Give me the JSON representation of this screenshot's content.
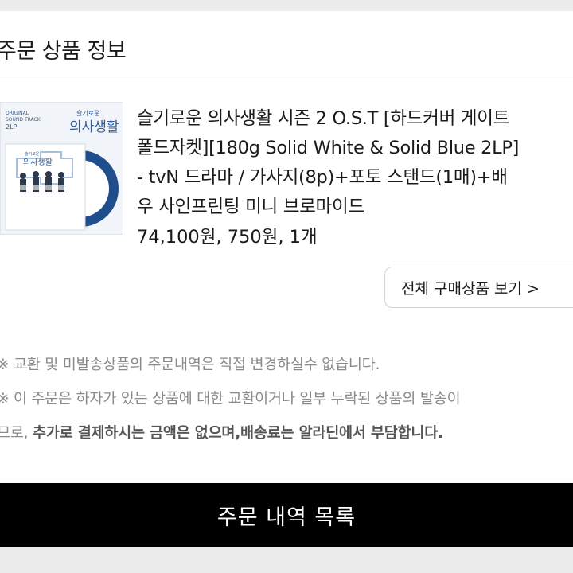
{
  "section": {
    "title": "주문 상품 정보"
  },
  "product": {
    "name_lines": [
      "슬기로운 의사생활 시즌 2 O.S.T [하드커버 게이트",
      "폴드자켓][180g Solid White & Solid Blue 2LP]",
      "- tvN 드라마 / 가사지(8p)+포토 스탠드(1매)+배",
      "우 사인프린팅 미니 브로마이드"
    ],
    "price_line": "74,100원, 750원, 1개",
    "thumbnail": {
      "title_small": "슬기로운",
      "title_large": "의사생활",
      "label_lines": [
        "ORIGINAL",
        "SOUND TRACK",
        "2LP"
      ]
    }
  },
  "view_all_button": {
    "label": "전체 구매상품 보기 >"
  },
  "notices": {
    "line1": "※ 교환 및 미발송상품의 주문내역은 직접 변경하실수 없습니다.",
    "line2": "※ 이 주문은 하자가 있는 상품에 대한 교환이거나 일부 누락된 상품의 발송이",
    "line3_prefix": "므로, ",
    "line3_bold": "추가로 결제하시는 금액은 없으며,배송료는 알라딘에서 부담합니다."
  },
  "order_list_button": {
    "label": "주문 내역 목록"
  },
  "colors": {
    "vinyl_blue": "#1f4e8c",
    "button_black": "#000000"
  }
}
